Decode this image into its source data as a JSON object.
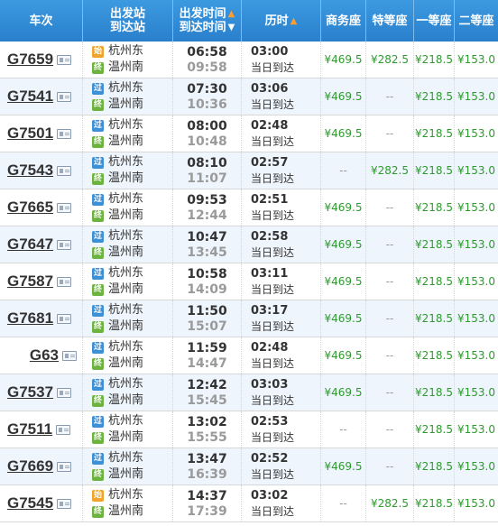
{
  "header": {
    "train": "车次",
    "station_from": "出发站",
    "station_to": "到达站",
    "time_depart": "出发时间",
    "time_arrive": "到达时间",
    "duration": "历时",
    "business": "商务座",
    "premium": "特等座",
    "first": "一等座",
    "second": "二等座"
  },
  "badges": {
    "start": "始",
    "pass": "过",
    "end": "终"
  },
  "rows": [
    {
      "train": "G7659",
      "from_badge": "始",
      "from": "杭州东",
      "to_badge": "终",
      "to": "温州南",
      "depart": "06:58",
      "arrive": "09:58",
      "duration": "03:00",
      "arrival_day": "当日到达",
      "business": "¥469.5",
      "premium": "¥282.5",
      "first": "¥218.5",
      "second": "¥153.0"
    },
    {
      "train": "G7541",
      "from_badge": "过",
      "from": "杭州东",
      "to_badge": "终",
      "to": "温州南",
      "depart": "07:30",
      "arrive": "10:36",
      "duration": "03:06",
      "arrival_day": "当日到达",
      "business": "¥469.5",
      "premium": "--",
      "first": "¥218.5",
      "second": "¥153.0"
    },
    {
      "train": "G7501",
      "from_badge": "过",
      "from": "杭州东",
      "to_badge": "终",
      "to": "温州南",
      "depart": "08:00",
      "arrive": "10:48",
      "duration": "02:48",
      "arrival_day": "当日到达",
      "business": "¥469.5",
      "premium": "--",
      "first": "¥218.5",
      "second": "¥153.0"
    },
    {
      "train": "G7543",
      "from_badge": "过",
      "from": "杭州东",
      "to_badge": "终",
      "to": "温州南",
      "depart": "08:10",
      "arrive": "11:07",
      "duration": "02:57",
      "arrival_day": "当日到达",
      "business": "--",
      "premium": "¥282.5",
      "first": "¥218.5",
      "second": "¥153.0"
    },
    {
      "train": "G7665",
      "from_badge": "过",
      "from": "杭州东",
      "to_badge": "终",
      "to": "温州南",
      "depart": "09:53",
      "arrive": "12:44",
      "duration": "02:51",
      "arrival_day": "当日到达",
      "business": "¥469.5",
      "premium": "--",
      "first": "¥218.5",
      "second": "¥153.0"
    },
    {
      "train": "G7647",
      "from_badge": "过",
      "from": "杭州东",
      "to_badge": "终",
      "to": "温州南",
      "depart": "10:47",
      "arrive": "13:45",
      "duration": "02:58",
      "arrival_day": "当日到达",
      "business": "¥469.5",
      "premium": "--",
      "first": "¥218.5",
      "second": "¥153.0"
    },
    {
      "train": "G7587",
      "from_badge": "过",
      "from": "杭州东",
      "to_badge": "终",
      "to": "温州南",
      "depart": "10:58",
      "arrive": "14:09",
      "duration": "03:11",
      "arrival_day": "当日到达",
      "business": "¥469.5",
      "premium": "--",
      "first": "¥218.5",
      "second": "¥153.0"
    },
    {
      "train": "G7681",
      "from_badge": "过",
      "from": "杭州东",
      "to_badge": "终",
      "to": "温州南",
      "depart": "11:50",
      "arrive": "15:07",
      "duration": "03:17",
      "arrival_day": "当日到达",
      "business": "¥469.5",
      "premium": "--",
      "first": "¥218.5",
      "second": "¥153.0"
    },
    {
      "train": "G63",
      "from_badge": "过",
      "from": "杭州东",
      "to_badge": "终",
      "to": "温州南",
      "depart": "11:59",
      "arrive": "14:47",
      "duration": "02:48",
      "arrival_day": "当日到达",
      "business": "¥469.5",
      "premium": "--",
      "first": "¥218.5",
      "second": "¥153.0"
    },
    {
      "train": "G7537",
      "from_badge": "过",
      "from": "杭州东",
      "to_badge": "终",
      "to": "温州南",
      "depart": "12:42",
      "arrive": "15:45",
      "duration": "03:03",
      "arrival_day": "当日到达",
      "business": "¥469.5",
      "premium": "--",
      "first": "¥218.5",
      "second": "¥153.0"
    },
    {
      "train": "G7511",
      "from_badge": "过",
      "from": "杭州东",
      "to_badge": "终",
      "to": "温州南",
      "depart": "13:02",
      "arrive": "15:55",
      "duration": "02:53",
      "arrival_day": "当日到达",
      "business": "--",
      "premium": "--",
      "first": "¥218.5",
      "second": "¥153.0"
    },
    {
      "train": "G7669",
      "from_badge": "过",
      "from": "杭州东",
      "to_badge": "终",
      "to": "温州南",
      "depart": "13:47",
      "arrive": "16:39",
      "duration": "02:52",
      "arrival_day": "当日到达",
      "business": "¥469.5",
      "premium": "--",
      "first": "¥218.5",
      "second": "¥153.0"
    },
    {
      "train": "G7545",
      "from_badge": "始",
      "from": "杭州东",
      "to_badge": "终",
      "to": "温州南",
      "depart": "14:37",
      "arrive": "17:39",
      "duration": "03:02",
      "arrival_day": "当日到达",
      "business": "--",
      "premium": "¥282.5",
      "first": "¥218.5",
      "second": "¥153.0"
    }
  ]
}
